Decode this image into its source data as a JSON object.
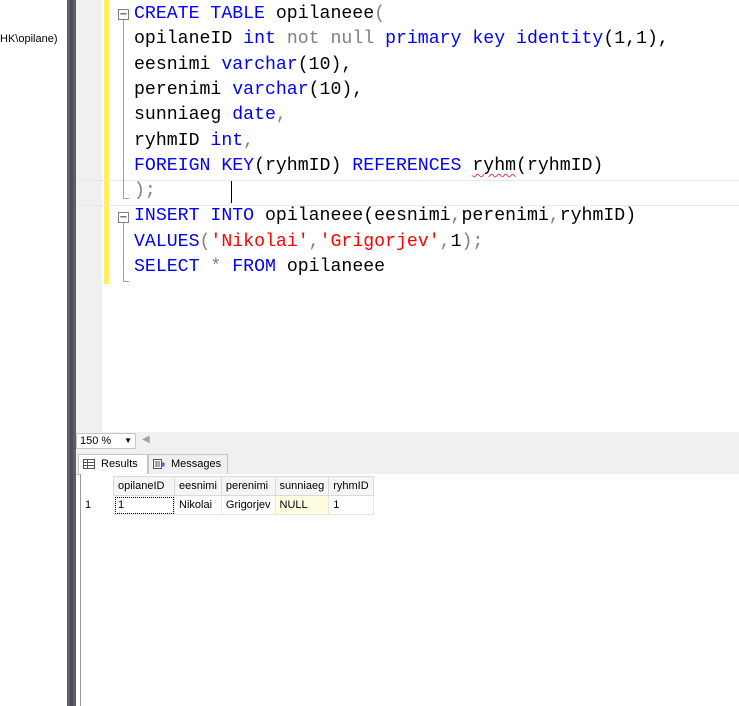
{
  "object_explorer": {
    "connection_label": "HK\\opilane)"
  },
  "editor": {
    "lines": [
      [
        {
          "t": "CREATE TABLE ",
          "c": "kw"
        },
        {
          "t": "opilaneee",
          "c": ""
        },
        {
          "t": "(",
          "c": "gr"
        }
      ],
      [
        {
          "t": "opilaneID ",
          "c": ""
        },
        {
          "t": "int ",
          "c": "kw"
        },
        {
          "t": "not null ",
          "c": "gr"
        },
        {
          "t": "primary key identity",
          "c": "kw"
        },
        {
          "t": "(1,1),",
          "c": ""
        }
      ],
      [
        {
          "t": "eesnimi ",
          "c": ""
        },
        {
          "t": "varchar",
          "c": "kw"
        },
        {
          "t": "(10),",
          "c": ""
        }
      ],
      [
        {
          "t": "perenimi ",
          "c": ""
        },
        {
          "t": "varchar",
          "c": "kw"
        },
        {
          "t": "(10),",
          "c": ""
        }
      ],
      [
        {
          "t": "sunniaeg ",
          "c": ""
        },
        {
          "t": "date",
          "c": "kw"
        },
        {
          "t": ",",
          "c": "gr"
        }
      ],
      [
        {
          "t": "ryhmID ",
          "c": ""
        },
        {
          "t": "int",
          "c": "kw"
        },
        {
          "t": ",",
          "c": "gr"
        }
      ],
      [
        {
          "t": "FOREIGN KEY",
          "c": "kw"
        },
        {
          "t": "(ryhmID) ",
          "c": ""
        },
        {
          "t": "REFERENCES ",
          "c": "kw"
        },
        {
          "t": "ryhm",
          "c": "sq"
        },
        {
          "t": "(ryhmID)",
          "c": ""
        }
      ],
      [
        {
          "t": ");",
          "c": "gr"
        }
      ],
      [
        {
          "t": "INSERT INTO ",
          "c": "kw"
        },
        {
          "t": "opilaneee",
          "c": ""
        },
        {
          "t": "(eesnimi",
          "c": ""
        },
        {
          "t": ",",
          "c": "gr"
        },
        {
          "t": "perenimi",
          "c": ""
        },
        {
          "t": ",",
          "c": "gr"
        },
        {
          "t": "ryhmID)",
          "c": ""
        }
      ],
      [
        {
          "t": "VALUES",
          "c": "kw"
        },
        {
          "t": "(",
          "c": "gr"
        },
        {
          "t": "'Nikolai'",
          "c": "st"
        },
        {
          "t": ",",
          "c": "gr"
        },
        {
          "t": "'Grigorjev'",
          "c": "st"
        },
        {
          "t": ",",
          "c": "gr"
        },
        {
          "t": "1",
          "c": ""
        },
        {
          "t": ");",
          "c": "gr"
        }
      ],
      [
        {
          "t": "SELECT ",
          "c": "kw"
        },
        {
          "t": "* ",
          "c": "gr"
        },
        {
          "t": "FROM ",
          "c": "kw"
        },
        {
          "t": "opilaneee",
          "c": ""
        }
      ]
    ]
  },
  "zoom": {
    "value": "150 %"
  },
  "tabs": {
    "results": "Results",
    "messages": "Messages"
  },
  "results": {
    "columns": [
      "opilaneID",
      "eesnimi",
      "perenimi",
      "sunniaeg",
      "ryhmID"
    ],
    "rows": [
      {
        "num": "1",
        "cells": [
          "1",
          "Nikolai",
          "Grigorjev",
          "NULL",
          "1"
        ]
      }
    ]
  },
  "colors": {
    "keyword": "#0000ff",
    "string": "#ff0000",
    "operator": "#808080",
    "change_marker": "#ffee62"
  }
}
